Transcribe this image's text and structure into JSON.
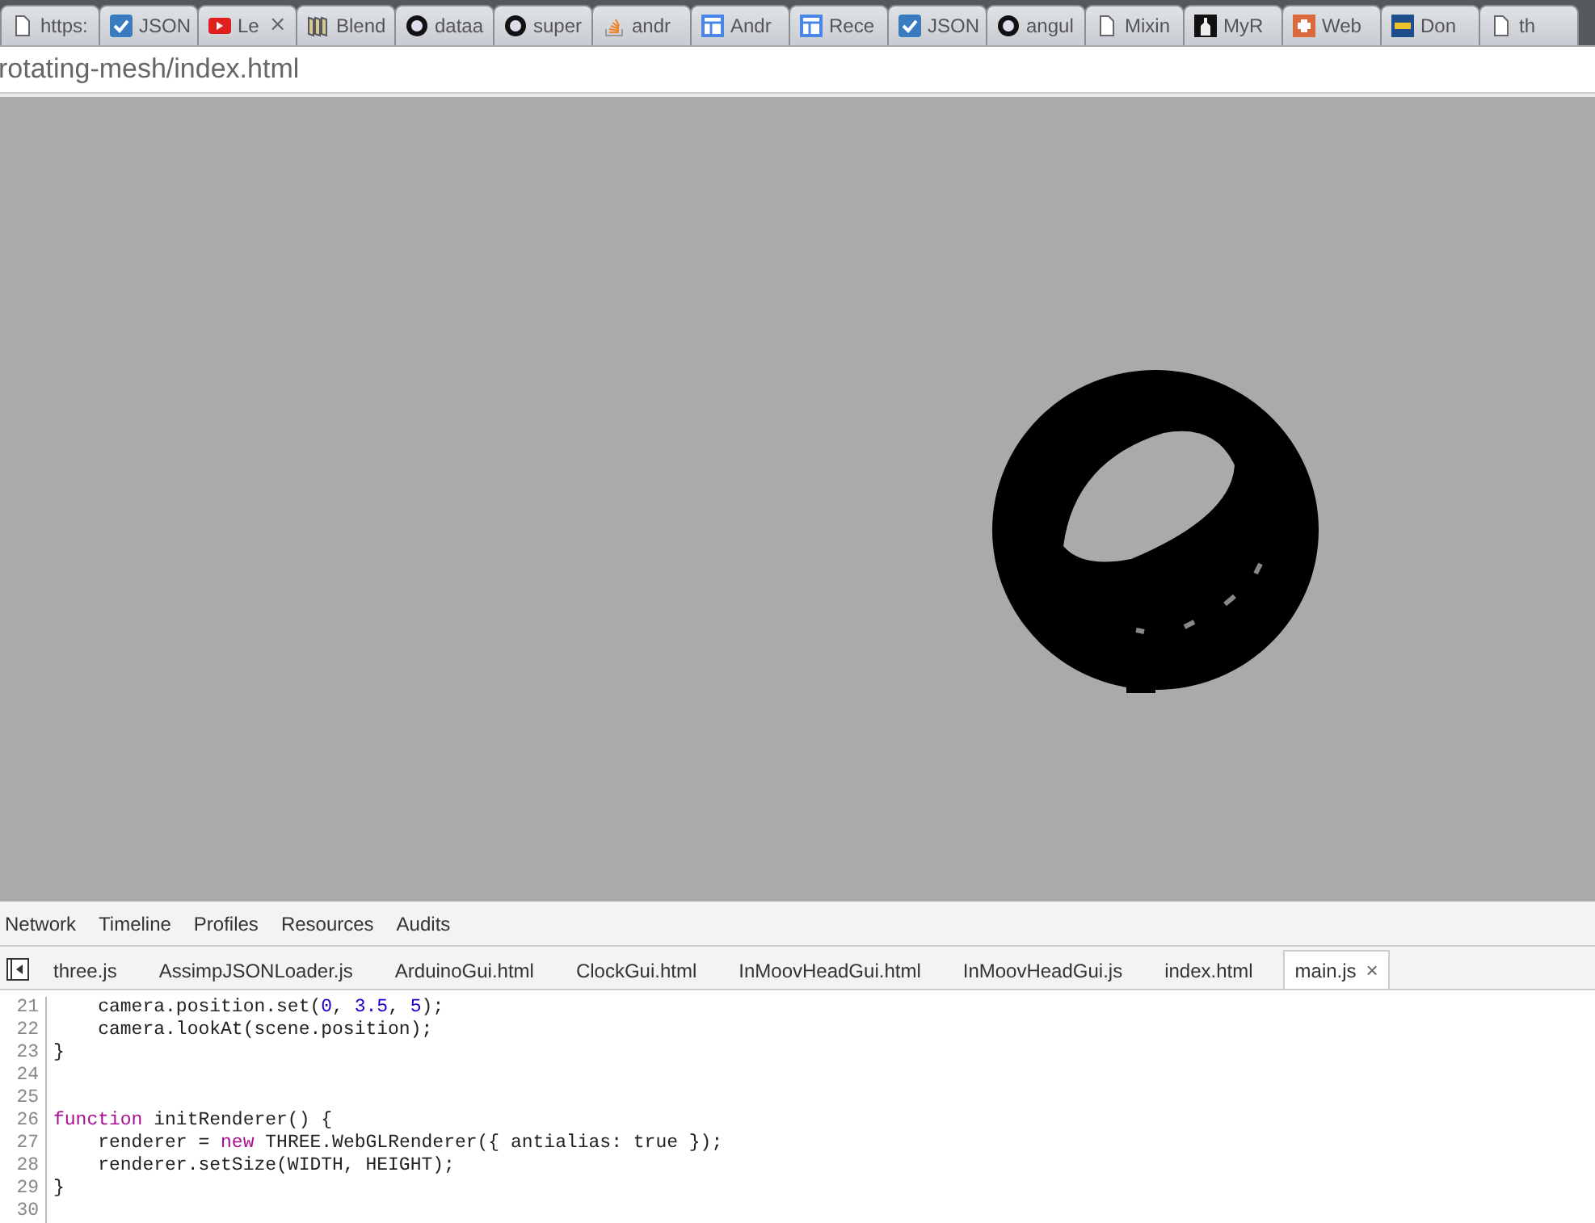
{
  "browser_tabs": [
    {
      "title": "https:"
    },
    {
      "title": "JSON"
    },
    {
      "title": "Le",
      "close": "×"
    },
    {
      "title": "Blend"
    },
    {
      "title": "dataa"
    },
    {
      "title": "super"
    },
    {
      "title": "andr"
    },
    {
      "title": "Andr"
    },
    {
      "title": "Rece"
    },
    {
      "title": "JSON"
    },
    {
      "title": "angul"
    },
    {
      "title": "Mixin"
    },
    {
      "title": "MyR"
    },
    {
      "title": "Web"
    },
    {
      "title": "Don"
    },
    {
      "title": "th"
    }
  ],
  "address_bar": {
    "value": "rotating-mesh/index.html"
  },
  "devtools": {
    "panels": [
      "Network",
      "Timeline",
      "Profiles",
      "Resources",
      "Audits"
    ],
    "file_tabs": [
      {
        "label": "three.js",
        "selected": false
      },
      {
        "label": "AssimpJSONLoader.js",
        "selected": false
      },
      {
        "label": "ArduinoGui.html",
        "selected": false
      },
      {
        "label": "ClockGui.html",
        "selected": false
      },
      {
        "label": "InMoovHeadGui.html",
        "selected": false
      },
      {
        "label": "InMoovHeadGui.js",
        "selected": false
      },
      {
        "label": "index.html",
        "selected": false
      },
      {
        "label": "main.js",
        "selected": true,
        "close": "×"
      }
    ],
    "code_lines": [
      {
        "number": "21",
        "tokens": [
          {
            "kind": "plain",
            "text": "    camera.position.set("
          },
          {
            "kind": "number",
            "text": "0"
          },
          {
            "kind": "plain",
            "text": ", "
          },
          {
            "kind": "number",
            "text": "3.5"
          },
          {
            "kind": "plain",
            "text": ", "
          },
          {
            "kind": "number",
            "text": "5"
          },
          {
            "kind": "plain",
            "text": ");"
          }
        ]
      },
      {
        "number": "22",
        "tokens": [
          {
            "kind": "plain",
            "text": "    camera.lookAt(scene.position);"
          }
        ]
      },
      {
        "number": "23",
        "tokens": [
          {
            "kind": "plain",
            "text": "}"
          }
        ]
      },
      {
        "number": "24"
      },
      {
        "number": "25"
      },
      {
        "number": "26",
        "tokens": [
          {
            "kind": "keyword",
            "text": "function"
          },
          {
            "kind": "plain",
            "text": " initRenderer() {"
          }
        ]
      },
      {
        "number": "27",
        "tokens": [
          {
            "kind": "plain",
            "text": "    renderer = "
          },
          {
            "kind": "keyword",
            "text": "new"
          },
          {
            "kind": "plain",
            "text": " THREE.WebGLRenderer({ antialias: true });"
          }
        ]
      },
      {
        "number": "28",
        "tokens": [
          {
            "kind": "plain",
            "text": "    renderer.setSize(WIDTH, HEIGHT);"
          }
        ]
      },
      {
        "number": "29",
        "tokens": [
          {
            "kind": "plain",
            "text": "}"
          }
        ]
      },
      {
        "number": "30"
      }
    ]
  }
}
